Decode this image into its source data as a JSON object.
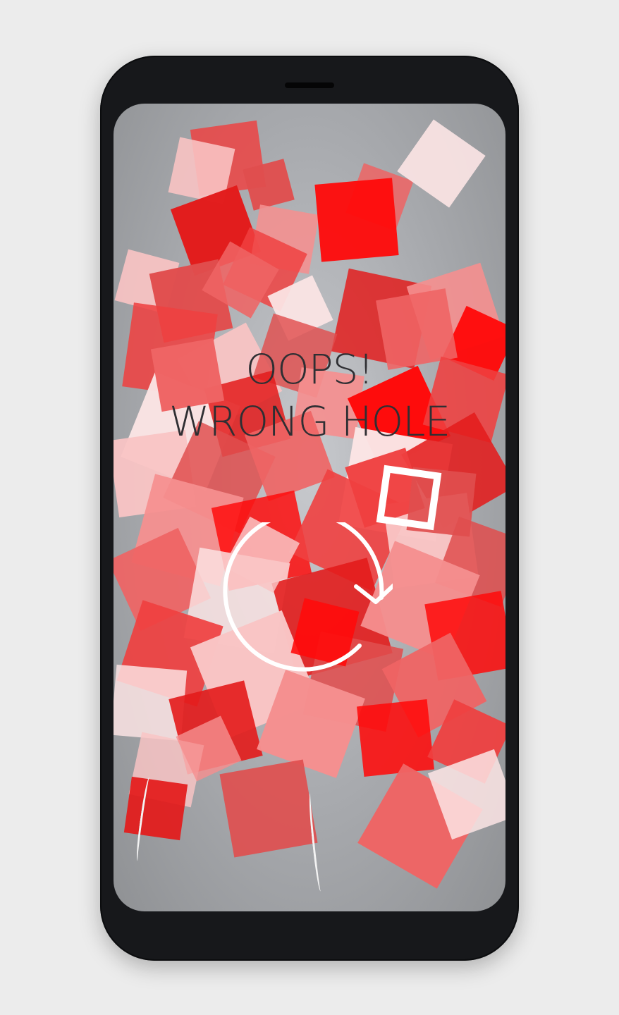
{
  "game": {
    "message_line1": "OOPS!",
    "message_line2": "WRONG HOLE"
  },
  "icons": {
    "restart": "restart-arrow-icon"
  },
  "colors": {
    "background": "#ececec",
    "phone_frame": "#17181b",
    "screen": "#a7a9ad",
    "message_text": "#2f2f33",
    "restart_icon": "#ffffff",
    "square_palette": [
      "#e31b1b",
      "#ef4040",
      "#ef6464",
      "#f58f8f",
      "#f9c4c4",
      "#fbe4e4",
      "#ff0a0a",
      "#e04e4e"
    ]
  }
}
